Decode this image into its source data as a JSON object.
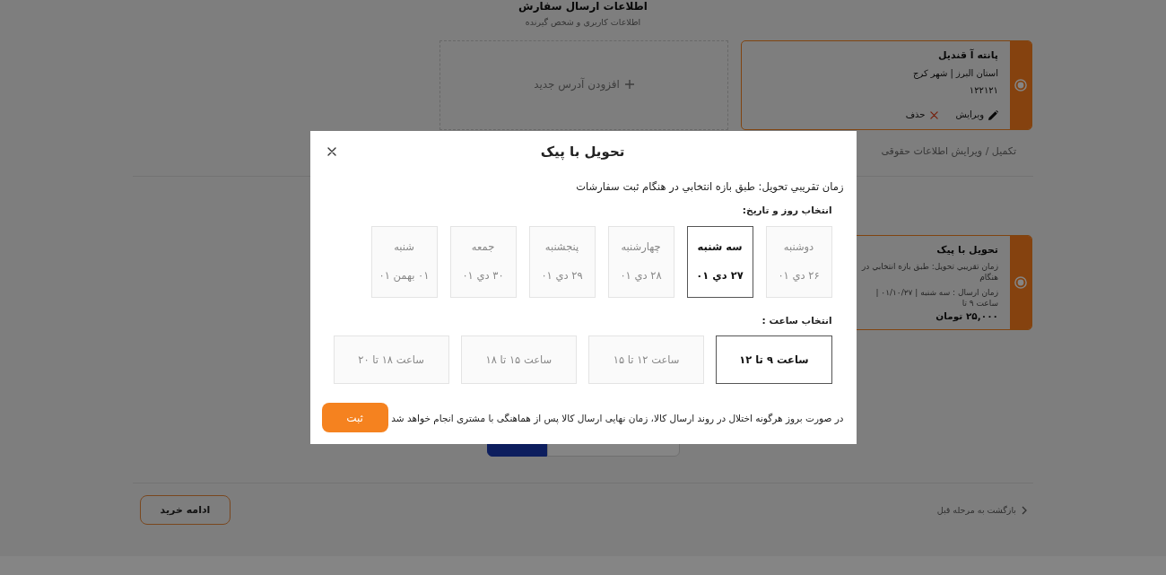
{
  "page": {
    "title": "اطلاعات ارسال سفارش",
    "subtitle": "اطلاعات کاربری و شخص گیرنده",
    "add_address": {
      "label": "افزودن آدرس جدید"
    },
    "addresses": [
      {
        "name": "پانته آ قندیل",
        "location": "استان البرز | شهر کرج",
        "postal_code": "۱۲۲۱۲۱",
        "selected": true,
        "actions": [
          {
            "kind": "edit",
            "label": "ویرایش"
          },
          {
            "kind": "delete",
            "label": "حذف"
          }
        ]
      }
    ],
    "legal_info_link": "تکمیل / ویرایش اطلاعات حقوقی",
    "shipping_methods": [
      {
        "title": "تحویل با پیک",
        "description": "زمان تقریبي تحویل: طبق بازه انتخابي در هنگام",
        "schedule": "زمان ارسال : سه شنبه | ۰۱/۱۰/۲۷ | ساعت ۹ تا",
        "price": "۲۵,۰۰۰ تومان",
        "selected": true
      }
    ],
    "segmented_control": [
      {
        "selected": false
      },
      {
        "selected": true
      }
    ],
    "footer": {
      "back_link": "بازگشت به مرحله قبل",
      "continue_button": "ادامه خرید"
    }
  },
  "modal": {
    "title": "تحویل با پیک",
    "intro": "زمان تقریبي تحویل: طبق بازه انتخابي در هنگام ثبت سفارشات",
    "day_label": "انتخاب روز و تاریخ:",
    "days": [
      {
        "weekday": "دوشنبه",
        "date": "۲۶ دي ۰۱",
        "selected": false
      },
      {
        "weekday": "سه شنبه",
        "date": "۲۷ دي ۰۱",
        "selected": true
      },
      {
        "weekday": "چهارشنبه",
        "date": "۲۸ دي ۰۱",
        "selected": false
      },
      {
        "weekday": "پنجشنبه",
        "date": "۲۹ دي ۰۱",
        "selected": false
      },
      {
        "weekday": "جمعه",
        "date": "۳۰ دي ۰۱",
        "selected": false
      },
      {
        "weekday": "شنبه",
        "date": "۰۱ بهمن ۰۱",
        "selected": false
      }
    ],
    "time_label": "انتخاب ساعت :",
    "times": [
      {
        "label": "ساعت ۹ تا ۱۲",
        "selected": true
      },
      {
        "label": "ساعت ۱۲ تا ۱۵",
        "selected": false
      },
      {
        "label": "ساعت ۱۵ تا ۱۸",
        "selected": false
      },
      {
        "label": "ساعت ۱۸ تا ۲۰",
        "selected": false
      }
    ],
    "note": "در صورت بروز هرگونه اختلال در روند ارسال کالا، زمان نهایی ارسال کالا پس از هماهنگی با مشتری انجام خواهد شد",
    "submit_button": "ثبت"
  }
}
